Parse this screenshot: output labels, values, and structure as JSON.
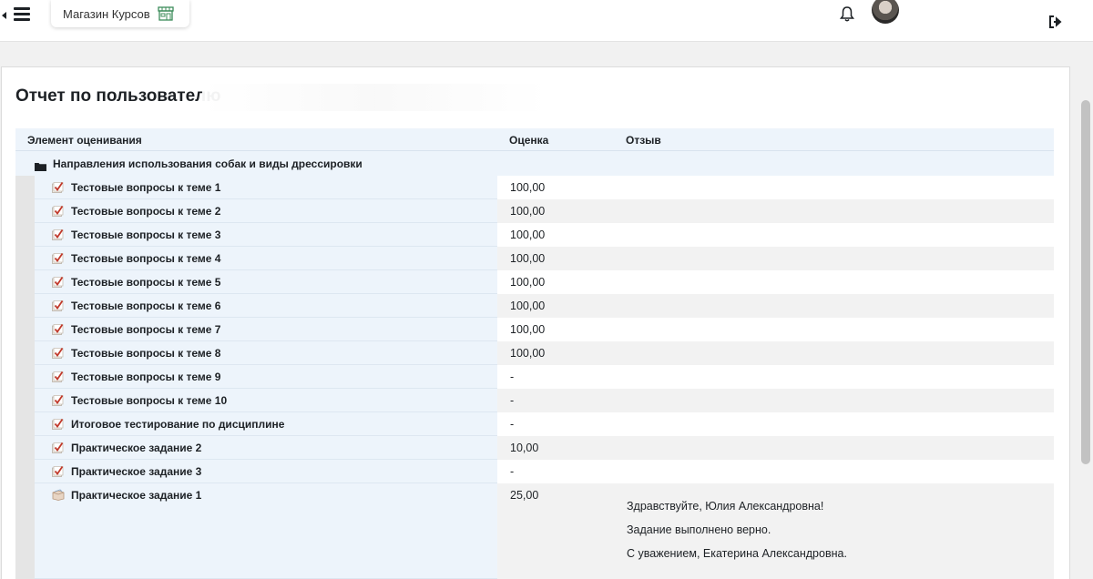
{
  "header": {
    "shop_label": "Магазин Курсов"
  },
  "page": {
    "title": "Отчет по пользователю"
  },
  "table": {
    "headers": {
      "item": "Элемент оценивания",
      "grade": "Оценка",
      "feedback": "Отзыв"
    },
    "category": "Направления использования собак и виды дрессировки",
    "rows": [
      {
        "name": "Тестовые вопросы к теме 1",
        "grade": "100,00",
        "icon": "quiz-icon"
      },
      {
        "name": "Тестовые вопросы к теме 2",
        "grade": "100,00",
        "icon": "quiz-icon"
      },
      {
        "name": "Тестовые вопросы к теме 3",
        "grade": "100,00",
        "icon": "quiz-icon"
      },
      {
        "name": "Тестовые вопросы к теме 4",
        "grade": "100,00",
        "icon": "quiz-icon"
      },
      {
        "name": "Тестовые вопросы к теме 5",
        "grade": "100,00",
        "icon": "quiz-icon"
      },
      {
        "name": "Тестовые вопросы к теме 6",
        "grade": "100,00",
        "icon": "quiz-icon"
      },
      {
        "name": "Тестовые вопросы к теме 7",
        "grade": "100,00",
        "icon": "quiz-icon"
      },
      {
        "name": "Тестовые вопросы к теме 8",
        "grade": "100,00",
        "icon": "quiz-icon"
      },
      {
        "name": "Тестовые вопросы к теме 9",
        "grade": "-",
        "icon": "quiz-icon"
      },
      {
        "name": "Тестовые вопросы к теме 10",
        "grade": "-",
        "icon": "quiz-icon"
      },
      {
        "name": "Итоговое тестирование по дисциплине",
        "grade": "-",
        "icon": "quiz-icon"
      },
      {
        "name": "Практическое задание 2",
        "grade": "10,00",
        "icon": "quiz-icon"
      },
      {
        "name": "Практическое задание 3",
        "grade": "-",
        "icon": "quiz-icon"
      },
      {
        "name": "Практическое задание 1",
        "grade": "25,00",
        "icon": "assignment-icon",
        "feedback": [
          "Здравствуйте, Юлия Александровна!",
          "Задание выполнено верно.",
          "С уважением, Екатерина Александровна."
        ]
      }
    ]
  },
  "colors": {
    "header_bg": "#edf4fb",
    "odd_row": "#ffffff",
    "even_row": "#f2f2f2",
    "quiz_check": "#c0392b"
  }
}
